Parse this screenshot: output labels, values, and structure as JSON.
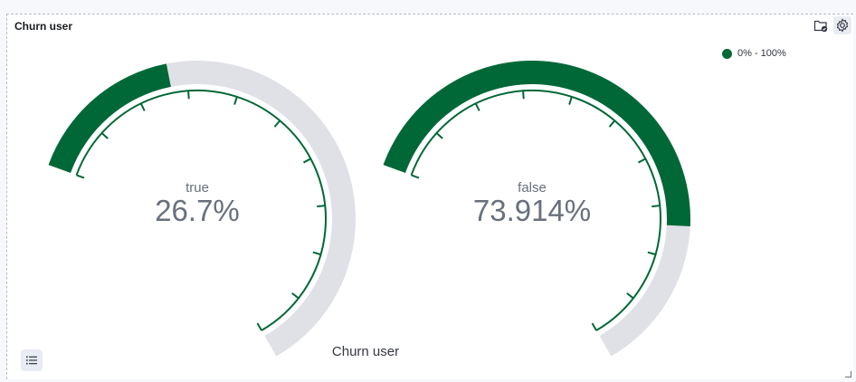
{
  "panel": {
    "title": "Churn user"
  },
  "icons": {
    "folder": "folder-check-icon",
    "settings": "gear-icon",
    "legend_toggle": "list-icon"
  },
  "legend": {
    "label": "0% - 100%",
    "color": "#006837"
  },
  "chart_data": {
    "type": "gauge",
    "title": "Churn user",
    "range": [
      0,
      100
    ],
    "fill_color": "#006837",
    "track_color": "#dfe1e6",
    "tick_color": "#006837",
    "value_color": "#69707d",
    "gauges": [
      {
        "label": "true",
        "value": 26.7,
        "display": "26.7%"
      },
      {
        "label": "false",
        "value": 73.914,
        "display": "73.914%"
      }
    ]
  }
}
